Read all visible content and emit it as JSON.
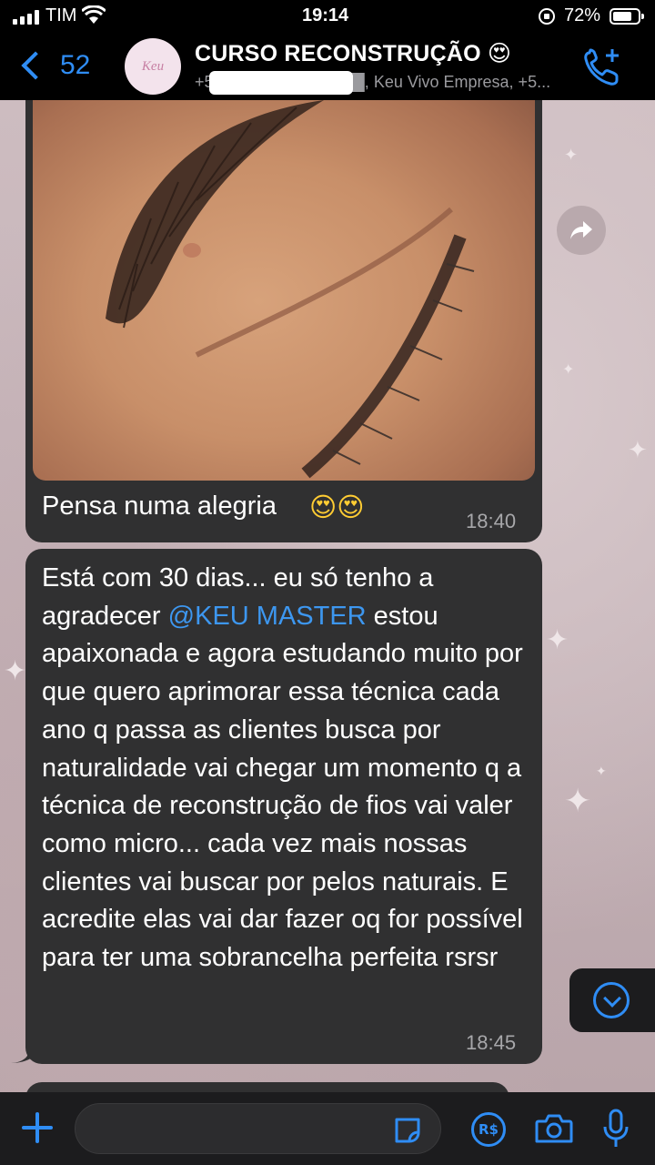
{
  "status_bar": {
    "carrier": "TIM",
    "time": "19:14",
    "battery": "72%"
  },
  "header": {
    "back_count": "52",
    "avatar_text": "Keu",
    "group_title": "CURSO RECONSTRUÇÃO 😍",
    "members": "+55 ██ █████-████, Keu Vivo Empresa, +5..."
  },
  "messages": [
    {
      "type": "image",
      "image_icon": "eyebrow-photo",
      "caption": "Pensa numa alegria",
      "caption_emoji": "😍😍",
      "time": "18:40"
    },
    {
      "type": "text",
      "text_before_mention": "Está com 30 dias... eu só tenho a agradecer ",
      "mention": "@KEU MASTER",
      "text_after_mention": " estou apaixonada e agora estudando muito por que quero aprimorar essa técnica cada ano q passa as clientes busca por naturalidade vai chegar um momento q a técnica de reconstrução de fios vai valer como micro... cada vez mais nossas clientes vai buscar por pelos naturais. E acredite elas vai dar fazer oq for possível para ter uma sobrancelha perfeita rsrsr",
      "time": "18:45"
    }
  ],
  "input_bar": {
    "placeholder": "",
    "value": ""
  },
  "icons": {
    "attach": "plus-icon",
    "sticker": "sticker-icon",
    "pay": "payment-icon",
    "camera": "camera-icon",
    "mic": "microphone-icon",
    "forward": "forward-icon",
    "scroll_down": "chevron-down-icon",
    "add_call": "add-call-icon"
  },
  "colors": {
    "accent": "#2f8df5",
    "bubble": "#303031",
    "bar": "#1c1c1e",
    "mention": "#3d97f0"
  }
}
